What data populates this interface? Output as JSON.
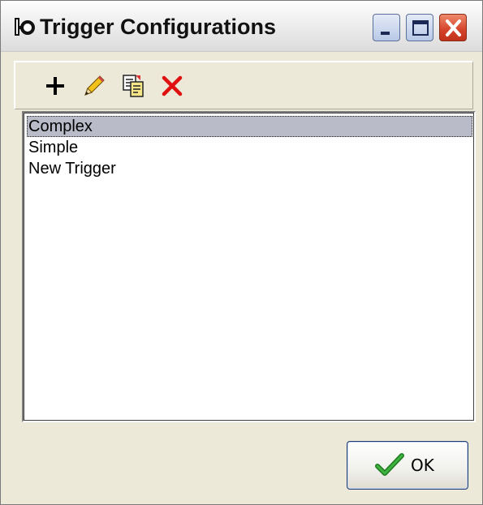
{
  "window": {
    "title": "Trigger Configurations",
    "icon": "scope-icon",
    "controls": [
      "minimize",
      "maximize",
      "close"
    ]
  },
  "toolbar": {
    "buttons": [
      {
        "name": "add",
        "icon": "plus-icon"
      },
      {
        "name": "edit",
        "icon": "pencil-icon"
      },
      {
        "name": "copy",
        "icon": "copy-icon"
      },
      {
        "name": "delete",
        "icon": "red-x-icon"
      }
    ]
  },
  "list": {
    "items": [
      {
        "label": "Complex",
        "selected": true
      },
      {
        "label": "Simple",
        "selected": false
      },
      {
        "label": "New Trigger",
        "selected": false
      }
    ]
  },
  "footer": {
    "ok_label": "OK",
    "ok_icon": "green-check-icon"
  },
  "colors": {
    "window_bg": "#ece9d8",
    "selection_bg": "#b9bcc8",
    "close_button": "#d4422a",
    "delete_icon": "#e01010",
    "check_icon": "#2e8b2e"
  }
}
